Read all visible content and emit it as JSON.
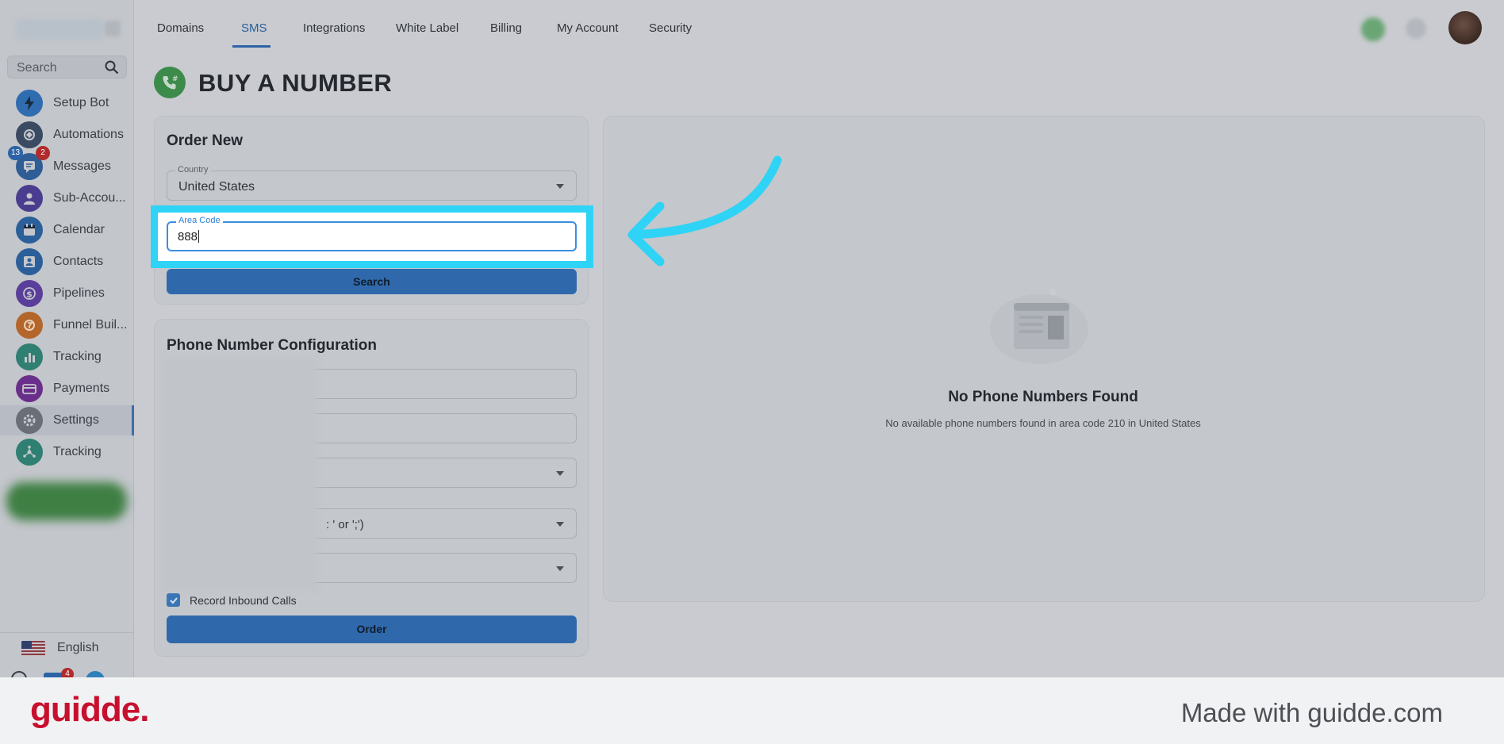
{
  "sidebar": {
    "search_placeholder": "Search",
    "items": [
      {
        "label": "Setup Bot",
        "icon": "bolt-icon",
        "color": "#2f6db0"
      },
      {
        "label": "Automations",
        "icon": "automation-icon",
        "color": "#3a4a63"
      },
      {
        "label": "Messages",
        "icon": "chat-icon",
        "color": "#2f5d96"
      },
      {
        "label": "Sub-Accou...",
        "icon": "user-icon",
        "color": "#4a3d8f"
      },
      {
        "label": "Calendar",
        "icon": "calendar-icon",
        "color": "#2b5f9a"
      },
      {
        "label": "Contacts",
        "icon": "contacts-icon",
        "color": "#2b5f9a"
      },
      {
        "label": "Pipelines",
        "icon": "dollar-icon",
        "color": "#5a3f9a"
      },
      {
        "label": "Funnel Buil...",
        "icon": "funnel-icon",
        "color": "#b4662a"
      },
      {
        "label": "Tracking",
        "icon": "chart-icon",
        "color": "#2f7f72"
      },
      {
        "label": "Payments",
        "icon": "card-icon",
        "color": "#6a2f8a"
      },
      {
        "label": "Settings",
        "icon": "gear-icon",
        "color": "#6a6f77"
      },
      {
        "label": "Tracking",
        "icon": "network-icon",
        "color": "#2f7f72"
      }
    ],
    "messages_badge_blue": "13",
    "messages_badge_red": "2",
    "bottom_badge": "4",
    "language": "English"
  },
  "topnav": {
    "tabs": [
      "Domains",
      "SMS",
      "Integrations",
      "White Label",
      "Billing",
      "My Account",
      "Security"
    ],
    "active_tab": "SMS"
  },
  "page": {
    "title": "BUY A NUMBER"
  },
  "order_new": {
    "title": "Order New",
    "country_label": "Country",
    "country_value": "United States",
    "area_code_label": "Area Code",
    "area_code_value": "888",
    "search_button": "Search"
  },
  "config": {
    "title": "Phone Number Configuration",
    "partial_hint": ": ' or ';')",
    "record_inbound_label": "Record Inbound Calls",
    "record_inbound_checked": true,
    "order_button": "Order"
  },
  "results": {
    "empty_title": "No Phone Numbers Found",
    "empty_message": "No available phone numbers found in area code 210 in United States"
  },
  "footer": {
    "brand": "guidde.",
    "made_with": "Made with guidde.com"
  },
  "colors": {
    "highlight": "#2fd3f6",
    "primary": "#2f69ac",
    "brand_red": "#c8102e"
  }
}
